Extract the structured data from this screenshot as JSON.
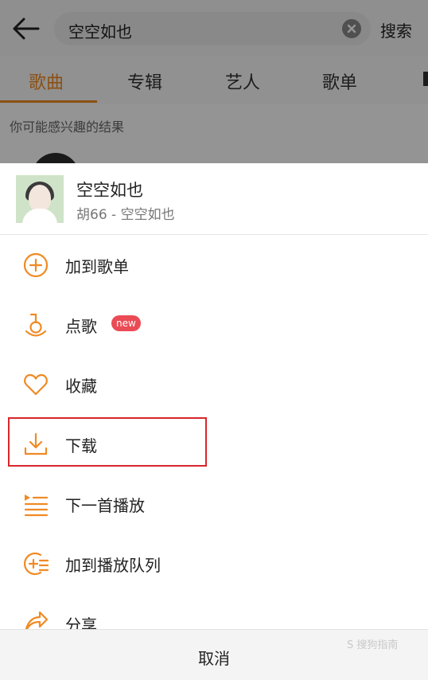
{
  "search": {
    "query": "空空如也",
    "button_label": "搜索"
  },
  "tabs": [
    {
      "label": "歌曲"
    },
    {
      "label": "专辑"
    },
    {
      "label": "艺人"
    },
    {
      "label": "歌单"
    }
  ],
  "results_hint": "你可能感兴趣的结果",
  "sheet": {
    "song_title": "空空如也",
    "song_subtitle": "胡66 - 空空如也",
    "items": [
      {
        "label": "加到歌单",
        "icon": "add-circle-icon"
      },
      {
        "label": "点歌",
        "icon": "microphone-icon",
        "badge": "new"
      },
      {
        "label": "收藏",
        "icon": "heart-icon"
      },
      {
        "label": "下载",
        "icon": "download-icon"
      },
      {
        "label": "下一首播放",
        "icon": "play-next-icon"
      },
      {
        "label": "加到播放队列",
        "icon": "add-to-queue-icon"
      },
      {
        "label": "分享",
        "icon": "share-icon"
      }
    ],
    "cancel_label": "取消"
  },
  "watermark": "S 搜狗指南",
  "colors": {
    "accent": "#f08a24",
    "badge": "#ea4b55",
    "highlight_border": "#d8262c"
  }
}
